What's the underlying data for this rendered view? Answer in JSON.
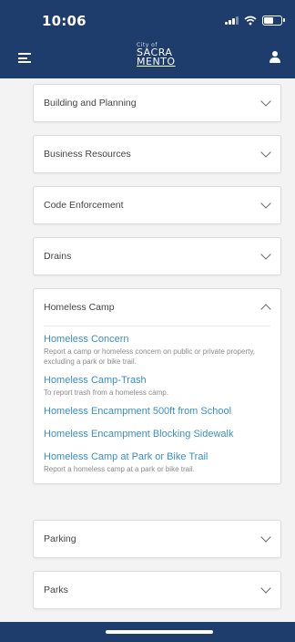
{
  "status": {
    "time": "10:06"
  },
  "header": {
    "logo_small": "City of",
    "logo_line1": "SACRA",
    "logo_line2": "MENTO"
  },
  "categories": [
    {
      "label": "Building and Planning"
    },
    {
      "label": "Business Resources"
    },
    {
      "label": "Code Enforcement"
    },
    {
      "label": "Drains"
    },
    {
      "label": "Homeless Camp"
    },
    {
      "label": "Parking"
    },
    {
      "label": "Parks"
    }
  ],
  "homeless_camp_items": [
    {
      "title": "Homeless Concern",
      "description": "Report a camp or homeless concern on public or private property, excluding a park or bike trail."
    },
    {
      "title": "Homeless Camp-Trash",
      "description": "To report trash from a homeless camp."
    },
    {
      "title": "Homeless Encampment 500ft from School",
      "description": ""
    },
    {
      "title": "Homeless Encampment Blocking Sidewalk",
      "description": ""
    },
    {
      "title": "Homeless Camp at Park or Bike Trail",
      "description": "Report a homeless camp at a park or bike trail."
    }
  ],
  "colors": {
    "brand": "#1f3d6c",
    "link": "#3a8fc5",
    "background": "#f3f3f3"
  },
  "icons": {
    "menu": "hamburger-icon",
    "user": "user-icon",
    "collapsed": "chevron-down-icon",
    "expanded": "chevron-up-icon"
  }
}
